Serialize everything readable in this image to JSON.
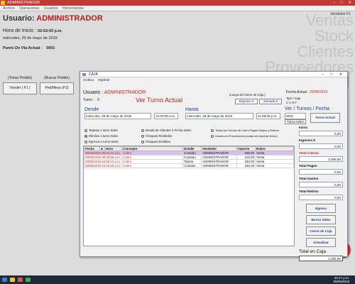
{
  "window": {
    "title": "ADMINISTRADOR"
  },
  "menu": [
    "Archivo",
    "Operaciones",
    "Usuarios",
    "Herramientas"
  ],
  "vendor_label": "Vendedor F1",
  "watermark": [
    "Ventas",
    "Stock",
    "Clientes",
    "Proveedores"
  ],
  "user": {
    "label": "Usuario:",
    "name": "ADMINISTRADOR"
  },
  "hora_inicio": {
    "label": "Hora de Inicio :",
    "value": "02:53:03 p.m."
  },
  "date_text": "miércoles, 29 de mayo de 2019",
  "punto_venta": {
    "label": "Punto De Vta Actual :",
    "value": "0001"
  },
  "top_buttons": [
    {
      "caption": "(Tomar Pedido)",
      "label": "Vender ( F1 )"
    },
    {
      "caption": "(Buscar Pedido)",
      "label": "Ped/Mesa (F2)"
    }
  ],
  "ghost_buttons": [
    "",
    "",
    "",
    ""
  ],
  "caja": {
    "title": "CAJA",
    "menu": [
      "Archivo",
      "Imprimir"
    ],
    "usuario_label": "Usuario :",
    "usuario": "ADMINISTRADOR",
    "turno_label": "Turno :",
    "turno": "0",
    "ver_turno": "Ver Turno Actual",
    "cierre_caption": "(Luego del Cierre de Caja )",
    "fecha_actual_label": "Fecha Actual :",
    "fecha_actual": "29/05/2019",
    "tipo_caja_label": "Tipo / Caja",
    "tipo_caja_options": "C  C  N  T",
    "reporte_x": "Reporte X",
    "jornada_z": "Jornada Z",
    "desde_label": "Desde",
    "hasta_label": "Hasta",
    "desde_fecha": "miércoles, 29 de   mayo    de 2019",
    "desde_hora": "12:00:00 a.m.",
    "hasta_fecha": "miércoles, 29 de   mayo    de 2019",
    "hasta_hora": "11:59:59 p.m.",
    "ver_turnos_label": "Ver / Turnos / Fecha",
    "turno_input": "0001",
    "turno_select": "Turno selec",
    "turno_actual_btn": "Turno Actual",
    "radios": [
      {
        "label": "Tarjetas x turno Selec",
        "on": false
      },
      {
        "label": "Efectivo  x turno Selec",
        "on": true
      },
      {
        "label": "Egresos x turno Selec",
        "on": false
      },
      {
        "label": "Deuda de Clientes X Fecha Selec",
        "on": false
      },
      {
        "label": "Cheques Recibidos",
        "on": false
      },
      {
        "label": "Cheques Emitidos",
        "on": false
      },
      {
        "label": "Todas las Formas de Cobro  Pagos  Gastos y Retiros",
        "on": false
      },
      {
        "label": "Deuda con Proveedores (todas  sin importar  fecha )",
        "on": false
      }
    ],
    "table": {
      "headers": [
        "Fecha",
        "&",
        "Hora",
        "Concepto",
        "Detalle",
        "Vendedor",
        "Importe",
        "Rubro"
      ],
      "rows": [
        [
          "08/05/2019 05:22:44 a.m.",
          "Cobro",
          "Contado",
          "ADMINISTRADOR",
          "630,00",
          "Venta"
        ],
        [
          "08/05/2019 09:26:55 a.m.",
          "Cobro",
          "Contado",
          "ADMINISTRADOR",
          "315,00",
          "Venta"
        ],
        [
          "08/05/2019 10:06:10 a.m.",
          "Cobro",
          "Tarjeta",
          "ADMINISTRADOR",
          "630,00",
          "Venta"
        ],
        [
          "29/05/2019 03:16:30 p.m.",
          "Cobro",
          "Contado",
          "ADMINISTRADOR",
          "630,00",
          "Venta"
        ]
      ]
    },
    "side": {
      "inicio_label": "Inicio",
      "inicio": "0,00",
      "ingresos_label": "Ingresos $",
      "ingresos": "0,00",
      "total_cobros_label": "Total Cobros",
      "total_cobros": "2.205,00",
      "total_pagos_label": "Total Pagos",
      "total_pagos": "0,00",
      "total_gastos_label": "Total Gastos",
      "total_gastos": "0,00",
      "total_retiros_label": "Total Retiros",
      "total_retiros": "0,00",
      "btn_egreso": "Egreso",
      "btn_borrar": "Borrar Selec",
      "btn_cierre": "Cierre de Caja",
      "btn_actualizar": "Actualizar",
      "total_caja_label": "Total en Caja",
      "total_caja": "2.205,00"
    }
  },
  "taskbar": {
    "time": "03:17 p.m.",
    "date": "29/05/2019"
  }
}
